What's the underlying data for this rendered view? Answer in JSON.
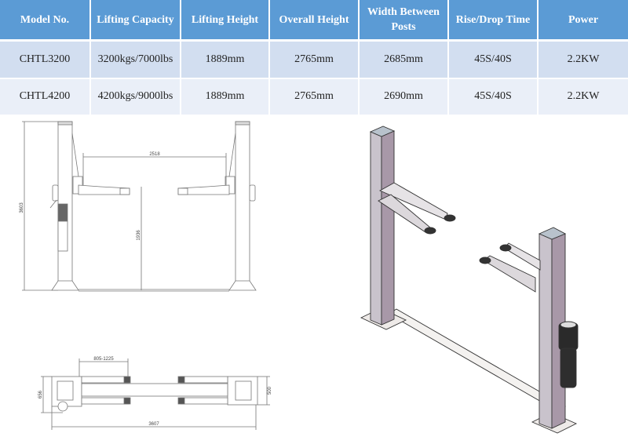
{
  "spec_table": {
    "headers": [
      "Model No.",
      "Lifting Capacity",
      "Lifting Height",
      "Overall Height",
      "Width Between Posts",
      "Rise/Drop Time",
      "Power"
    ],
    "rows": [
      {
        "model": "CHTL3200",
        "capacity": "3200kgs/7000lbs",
        "lifting_height": "1889mm",
        "overall_height": "2765mm",
        "width_between_posts": "2685mm",
        "rise_drop_time": "45S/40S",
        "power": "2.2KW"
      },
      {
        "model": "CHTL4200",
        "capacity": "4200kgs/9000lbs",
        "lifting_height": "1889mm",
        "overall_height": "2765mm",
        "width_between_posts": "2690mm",
        "rise_drop_time": "45S/40S",
        "power": "2.2KW"
      }
    ]
  },
  "front_view_drawing": {
    "dimensions": {
      "overall_height": "3603",
      "arm_span": "2518",
      "lift_height": "1936"
    }
  },
  "top_view_drawing": {
    "dimensions": {
      "arm_reach": "805-1225",
      "overall_width": "3607",
      "base_depth_left": "656",
      "base_depth_right": "500"
    }
  },
  "iso_view_drawing": {
    "label": "two-post-lift-3d-render",
    "colors": {
      "post_face": "#c9c3cc",
      "post_side": "#a898a8",
      "post_top": "#b8c2cc",
      "motor": "#2a2a2a"
    }
  }
}
